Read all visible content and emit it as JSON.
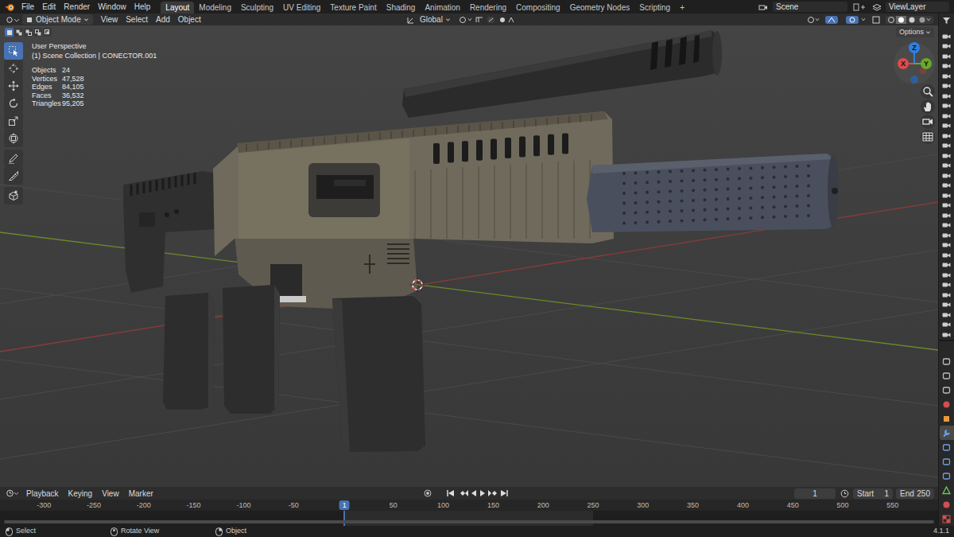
{
  "topbar": {
    "menus": [
      "File",
      "Edit",
      "Render",
      "Window",
      "Help"
    ],
    "workspaces": [
      {
        "label": "Layout",
        "selected": true
      },
      {
        "label": "Modeling",
        "selected": false
      },
      {
        "label": "Sculpting",
        "selected": false
      },
      {
        "label": "UV Editing",
        "selected": false
      },
      {
        "label": "Texture Paint",
        "selected": false
      },
      {
        "label": "Shading",
        "selected": false
      },
      {
        "label": "Animation",
        "selected": false
      },
      {
        "label": "Rendering",
        "selected": false
      },
      {
        "label": "Compositing",
        "selected": false
      },
      {
        "label": "Geometry Nodes",
        "selected": false
      },
      {
        "label": "Scripting",
        "selected": false
      }
    ],
    "add_workspace": "+",
    "scene": "Scene",
    "view_layer": "ViewLayer"
  },
  "viewport_header": {
    "mode": "Object Mode",
    "menus": [
      "View",
      "Select",
      "Add",
      "Object"
    ],
    "orientation": "Global"
  },
  "selection_modes": [
    {
      "kind": "set",
      "selected": true
    },
    {
      "kind": "extend",
      "selected": false
    },
    {
      "kind": "subtract",
      "selected": false
    },
    {
      "kind": "invert",
      "selected": false
    },
    {
      "kind": "intersect",
      "selected": false
    }
  ],
  "toolbar": [
    {
      "kind": "select",
      "selected": true
    },
    {
      "kind": "cursor",
      "selected": false
    },
    {
      "kind": "move",
      "selected": false
    },
    {
      "kind": "rotate",
      "selected": false
    },
    {
      "kind": "scale",
      "selected": false
    },
    {
      "kind": "transform",
      "selected": false
    },
    {
      "kind": "annotate",
      "selected": false
    },
    {
      "kind": "measure",
      "selected": false
    },
    {
      "kind": "add-cube",
      "selected": false
    }
  ],
  "overlay": {
    "view": "User Perspective",
    "collection": "(1) Scene Collection | CONECTOR.001",
    "stats": [
      {
        "label": "Objects",
        "value": "24"
      },
      {
        "label": "Vertices",
        "value": "47,528"
      },
      {
        "label": "Edges",
        "value": "84,105"
      },
      {
        "label": "Faces",
        "value": "36,532"
      },
      {
        "label": "Triangles",
        "value": "95,205"
      }
    ]
  },
  "options": "Options",
  "gizmo": {
    "x": "X",
    "y": "Y",
    "z": "Z"
  },
  "properties_tabs": [
    {
      "kind": "tool",
      "selected": false
    },
    {
      "kind": "render",
      "selected": false
    },
    {
      "kind": "output",
      "selected": false
    },
    {
      "kind": "world",
      "selected": false
    },
    {
      "kind": "object",
      "selected": false
    },
    {
      "kind": "modifiers",
      "selected": true
    },
    {
      "kind": "particles",
      "selected": false
    },
    {
      "kind": "physics",
      "selected": false
    },
    {
      "kind": "constraints",
      "selected": false
    },
    {
      "kind": "data",
      "selected": false
    },
    {
      "kind": "material",
      "selected": false
    },
    {
      "kind": "texture",
      "selected": false
    }
  ],
  "timeline": {
    "menus": [
      "Playback",
      "Keying",
      "View",
      "Marker"
    ],
    "current_frame": "1",
    "start_label": "Start",
    "start": "1",
    "end_label": "End",
    "end": "250",
    "playhead": "1",
    "ruler": [
      "-300",
      "-250",
      "-200",
      "-150",
      "-100",
      "-50",
      "50",
      "100",
      "150",
      "200",
      "250",
      "300",
      "350",
      "400",
      "450",
      "500",
      "550"
    ]
  },
  "status_bar": {
    "hints": [
      "Select",
      "Rotate View",
      "Object"
    ],
    "version": "4.1.1"
  }
}
